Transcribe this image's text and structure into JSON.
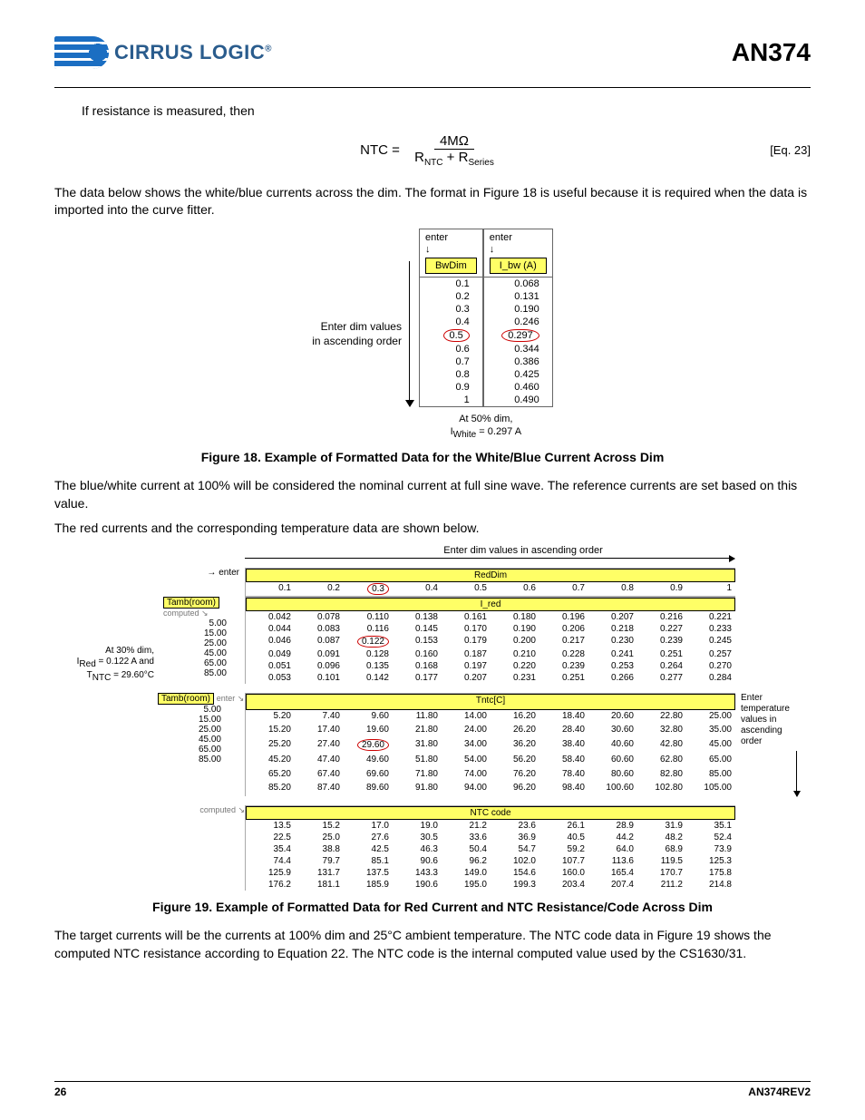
{
  "header": {
    "logo_text": "CIRRUS LOGIC",
    "doc_code": "AN374"
  },
  "intro1": "If resistance is measured, then",
  "equation23": {
    "lhs": "NTC",
    "numerator": "4MΩ",
    "den_left": "R",
    "den_left_sub": "NTC",
    "den_plus": " + ",
    "den_right": "R",
    "den_right_sub": "Series",
    "eqnum": "[Eq. 23]"
  },
  "para1": "The data below shows the white/blue currents across the dim. The format in Figure 18 is useful because it is required when the data is imported into the curve fitter.",
  "fig18": {
    "left_note_1": "Enter dim values",
    "left_note_2": "in ascending order",
    "col1_enter": "enter",
    "col1_arrow": "↓",
    "col1_title": "BwDim",
    "col1_vals": [
      "0.1",
      "0.2",
      "0.3",
      "0.4",
      "0.5",
      "0.6",
      "0.7",
      "0.8",
      "0.9",
      "1"
    ],
    "col1_circled_index": 4,
    "col2_enter": "enter",
    "col2_arrow": "↓",
    "col2_title": "I_bw (A)",
    "col2_vals": [
      "0.068",
      "0.131",
      "0.190",
      "0.246",
      "0.297",
      "0.344",
      "0.386",
      "0.425",
      "0.460",
      "0.490"
    ],
    "col2_circled_index": 4,
    "footnote_1": "At 50% dim,",
    "footnote_2": "I_White = 0.297 A",
    "caption": "Figure 18.  Example of Formatted Data for the White/Blue Current Across Dim"
  },
  "para2": "The blue/white current at 100% will be considered the nominal current at full sine wave. The reference currents are set based on this value.",
  "para3": "The red currents and the corresponding temperature data are shown below.",
  "fig19": {
    "top_note": "Enter dim values in ascending order",
    "enter_arrow": "→ enter",
    "tamb_label": "Tamb(room)",
    "computed_tag": "computed ↘",
    "enter_tag": "enter ↘",
    "reddim_header": "RedDim",
    "reddim_cols": [
      "0.1",
      "0.2",
      "0.3",
      "0.4",
      "0.5",
      "0.6",
      "0.7",
      "0.8",
      "0.9",
      "1"
    ],
    "reddim_circled_index": 2,
    "tamb_vals": [
      "5.00",
      "15.00",
      "25.00",
      "45.00",
      "65.00",
      "85.00"
    ],
    "ired_label": "I_red",
    "ired_rows": [
      [
        "0.042",
        "0.078",
        "0.110",
        "0.138",
        "0.161",
        "0.180",
        "0.196",
        "0.207",
        "0.216",
        "0.221"
      ],
      [
        "0.044",
        "0.083",
        "0.116",
        "0.145",
        "0.170",
        "0.190",
        "0.206",
        "0.218",
        "0.227",
        "0.233"
      ],
      [
        "0.046",
        "0.087",
        "0.122",
        "0.153",
        "0.179",
        "0.200",
        "0.217",
        "0.230",
        "0.239",
        "0.245"
      ],
      [
        "0.049",
        "0.091",
        "0.128",
        "0.160",
        "0.187",
        "0.210",
        "0.228",
        "0.241",
        "0.251",
        "0.257"
      ],
      [
        "0.051",
        "0.096",
        "0.135",
        "0.168",
        "0.197",
        "0.220",
        "0.239",
        "0.253",
        "0.264",
        "0.270"
      ],
      [
        "0.053",
        "0.101",
        "0.142",
        "0.177",
        "0.207",
        "0.231",
        "0.251",
        "0.266",
        "0.277",
        "0.284"
      ]
    ],
    "ired_circled": {
      "row": 2,
      "col": 2
    },
    "left_callout_1": "At 30% dim,",
    "left_callout_2": "I_Red = 0.122 A and",
    "left_callout_3": "T_NTC = 29.60°C",
    "tntc_label": "Tntc[C]",
    "tntc_rows": [
      [
        "5.20",
        "7.40",
        "9.60",
        "11.80",
        "14.00",
        "16.20",
        "18.40",
        "20.60",
        "22.80",
        "25.00"
      ],
      [
        "15.20",
        "17.40",
        "19.60",
        "21.80",
        "24.00",
        "26.20",
        "28.40",
        "30.60",
        "32.80",
        "35.00"
      ],
      [
        "25.20",
        "27.40",
        "29.60",
        "31.80",
        "34.00",
        "36.20",
        "38.40",
        "40.60",
        "42.80",
        "45.00"
      ],
      [
        "45.20",
        "47.40",
        "49.60",
        "51.80",
        "54.00",
        "56.20",
        "58.40",
        "60.60",
        "62.80",
        "65.00"
      ],
      [
        "65.20",
        "67.40",
        "69.60",
        "71.80",
        "74.00",
        "76.20",
        "78.40",
        "80.60",
        "82.80",
        "85.00"
      ],
      [
        "85.20",
        "87.40",
        "89.60",
        "91.80",
        "94.00",
        "96.20",
        "98.40",
        "100.60",
        "102.80",
        "105.00"
      ]
    ],
    "tntc_circled": {
      "row": 2,
      "col": 2
    },
    "right_note": "Enter temperature values in ascending order",
    "ntc_label": "NTC code",
    "ntc_rows": [
      [
        "13.5",
        "15.2",
        "17.0",
        "19.0",
        "21.2",
        "23.6",
        "26.1",
        "28.9",
        "31.9",
        "35.1"
      ],
      [
        "22.5",
        "25.0",
        "27.6",
        "30.5",
        "33.6",
        "36.9",
        "40.5",
        "44.2",
        "48.2",
        "52.4"
      ],
      [
        "35.4",
        "38.8",
        "42.5",
        "46.3",
        "50.4",
        "54.7",
        "59.2",
        "64.0",
        "68.9",
        "73.9"
      ],
      [
        "74.4",
        "79.7",
        "85.1",
        "90.6",
        "96.2",
        "102.0",
        "107.7",
        "113.6",
        "119.5",
        "125.3"
      ],
      [
        "125.9",
        "131.7",
        "137.5",
        "143.3",
        "149.0",
        "154.6",
        "160.0",
        "165.4",
        "170.7",
        "175.8"
      ],
      [
        "176.2",
        "181.1",
        "185.9",
        "190.6",
        "195.0",
        "199.3",
        "203.4",
        "207.4",
        "211.2",
        "214.8"
      ]
    ],
    "caption": "Figure 19.  Example of Formatted Data for Red Current and NTC Resistance/Code Across Dim"
  },
  "para4": "The target currents will be the currents at 100% dim and 25°C ambient temperature. The NTC code data in Figure 19 shows the computed NTC resistance according to Equation 22. The NTC code is the internal computed value used by the CS1630/31.",
  "footer": {
    "page": "26",
    "rev": "AN374REV2"
  }
}
